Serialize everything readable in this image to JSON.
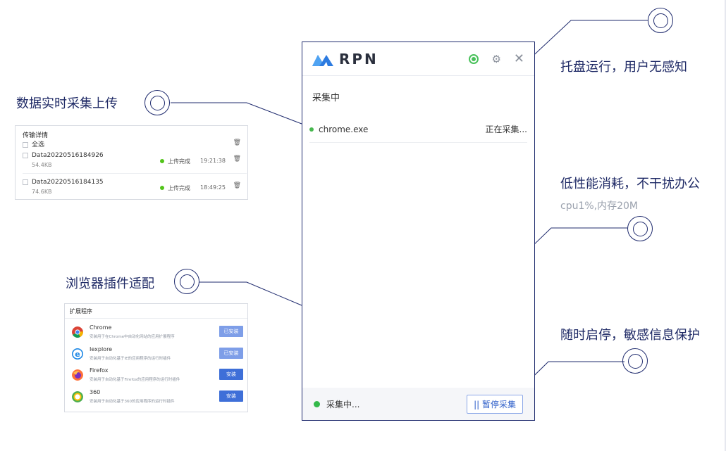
{
  "captions": {
    "tray": "托盘运行，用户无感知",
    "upload": "数据实时采集上传",
    "lowcost": "低性能消耗，不干扰办公",
    "lowcost_sub": "cpu1%,内存20M",
    "plugins": "浏览器插件适配",
    "pause": "随时启停，敏感信息保护"
  },
  "app": {
    "brand": "RPN",
    "status_title": "采集中",
    "process_name": "chrome.exe",
    "process_state": "正在采集...",
    "footer_status": "采集中...",
    "pause_button": "|| 暂停采集"
  },
  "transfer": {
    "title": "传输详情",
    "select_all": "全选",
    "rows": [
      {
        "name": "Data20220516184926",
        "size": "54.4KB",
        "status": "上传完成",
        "time": "19:21:38"
      },
      {
        "name": "Data20220516184135",
        "size": "74.6KB",
        "status": "上传完成",
        "time": "18:49:25"
      }
    ]
  },
  "extensions": {
    "title": "扩展程序",
    "items": [
      {
        "name": "Chrome",
        "desc": "安装用于在Chrome中自动化网站的应用扩展程序",
        "button": "已安装",
        "icon": "chrome-icon"
      },
      {
        "name": "Iexplore",
        "desc": "安装用于自动化基于IE的应用程序的运行时插件",
        "button": "已安装",
        "icon": "ie-icon"
      },
      {
        "name": "Firefox",
        "desc": "安装用于自动化基于Firefox的应用程序的运行时插件",
        "button": "安装",
        "icon": "firefox-icon"
      },
      {
        "name": "360",
        "desc": "安装用于自动化基于360的应用程序的运行时插件",
        "button": "安装",
        "icon": "360-icon"
      }
    ]
  },
  "colors": {
    "accent": "#1f2b6e",
    "green": "#33b94a",
    "brand_blue": "#2d7be0"
  }
}
